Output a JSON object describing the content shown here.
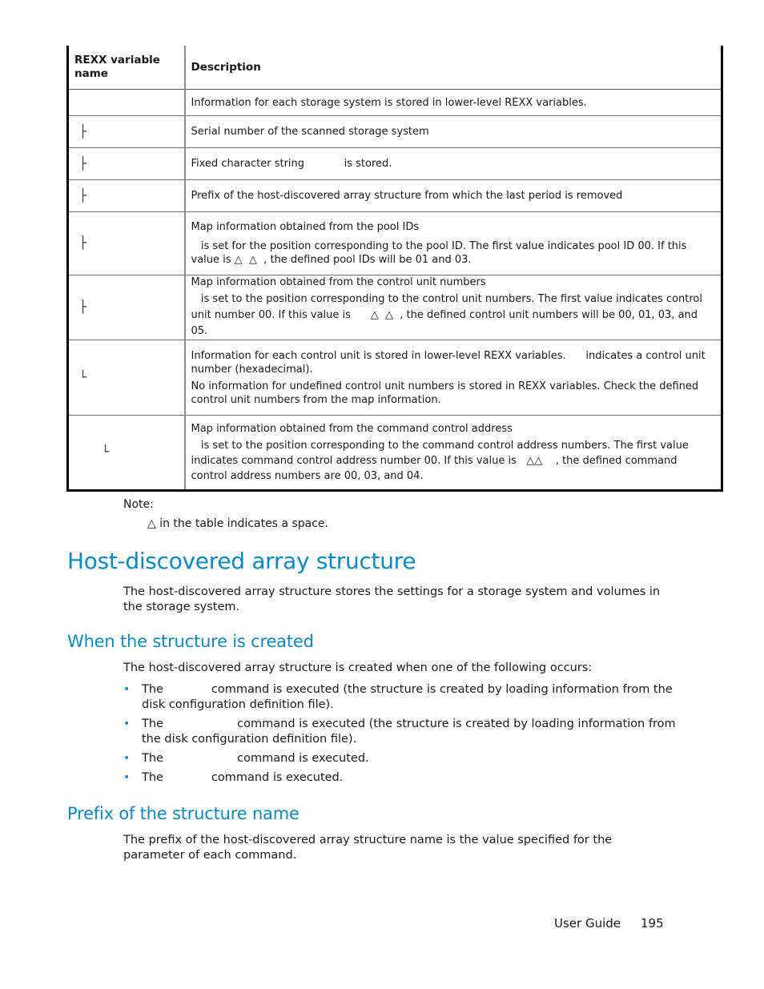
{
  "table": {
    "headers": {
      "name": "REXX variable name",
      "description": "Description"
    },
    "rows": [
      {
        "glyph": "",
        "glyph_icon": "none",
        "desc": [
          "Information for each storage system is stored in lower-level REXX variables."
        ]
      },
      {
        "glyph": "├",
        "glyph_icon": "tree-branch-icon",
        "desc": [
          "Serial number of the scanned storage system"
        ]
      },
      {
        "glyph": "├",
        "glyph_icon": "tree-branch-icon",
        "desc": [
          "Fixed character string            is stored."
        ]
      },
      {
        "glyph": "├",
        "glyph_icon": "tree-branch-icon",
        "desc": [
          "Prefix of the host-discovered array structure from which the last period is removed"
        ]
      },
      {
        "glyph": "├",
        "glyph_icon": "tree-branch-icon",
        "desc": [
          "Map information obtained from the pool IDs",
          "   is set for the position corresponding to the pool ID. The first value indicates pool ID 00. If this value is △  △  , the defined pool IDs will be 01 and 03."
        ]
      },
      {
        "glyph": "├",
        "glyph_icon": "tree-branch-icon",
        "desc": [
          "Map information obtained from the control unit numbers",
          "   is set to the position corresponding to the control unit numbers. The first value indicates control unit number 00. If this value is      △  △  , the defined control unit numbers will be 00, 01, 03, and 05."
        ]
      },
      {
        "glyph": "└",
        "glyph_icon": "tree-end-icon",
        "desc": [
          "Information for each control unit is stored in lower-level REXX variables.      indicates a control unit number (hexadecimal).",
          "No information for undefined control unit numbers is stored in REXX variables. Check the defined control unit numbers from the map information."
        ]
      },
      {
        "glyph": "└",
        "glyph_icon": "tree-end-icon",
        "indent": true,
        "desc": [
          "Map information obtained from the command control address",
          "   is set to the position corresponding to the command control address numbers. The first value indicates command control address number 00. If this value is   △△    , the defined command control address numbers are 00, 03, and 04."
        ]
      }
    ]
  },
  "note": {
    "label": "Note:",
    "text": "△ in the table indicates a space."
  },
  "section": {
    "title": "Host-discovered array structure",
    "intro": "The host-discovered array structure stores the settings for a storage system and volumes in the storage system."
  },
  "when_created": {
    "title": "When the structure is created",
    "intro": "The host-discovered array structure is created when one of the following occurs:",
    "bullet_icon": "•",
    "items": [
      "The             command is executed (the structure is created by loading information from the disk configuration definition file).",
      "The                    command is executed (the structure is created by loading information from the disk configuration definition file).",
      "The                    command is executed.",
      "The             command is executed."
    ]
  },
  "prefix": {
    "title": "Prefix of the structure name",
    "text": "The prefix of the host-discovered array structure name is the value specified for the          parameter of each command."
  },
  "footer": {
    "label": "User Guide",
    "page": "195"
  },
  "colors": {
    "heading": "#0a8ac9",
    "bullet": "#0a8ac9",
    "text": "#1a1a1a"
  }
}
